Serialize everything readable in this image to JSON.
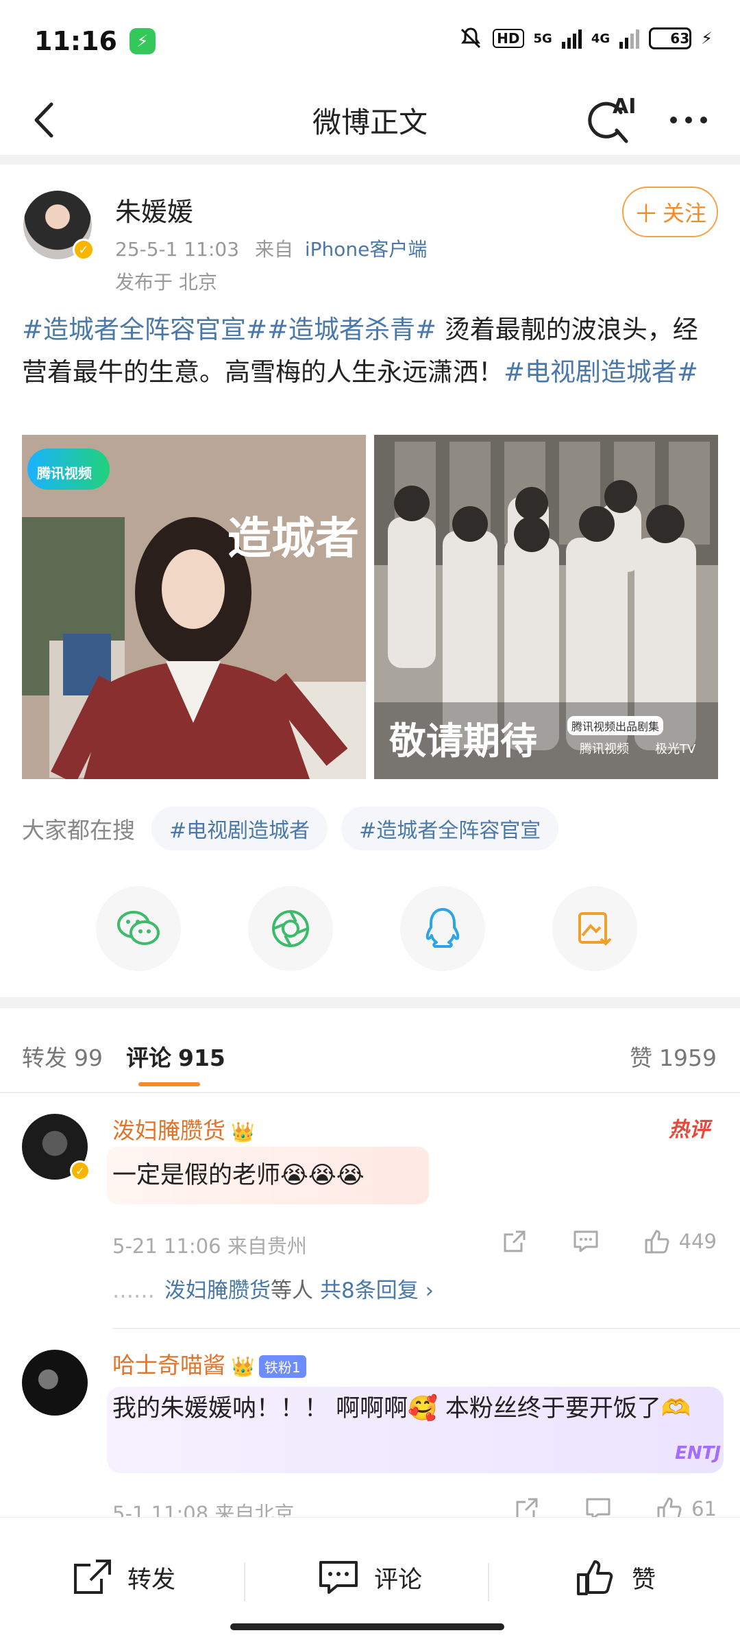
{
  "status_bar": {
    "time": "11:16",
    "network1": "5G",
    "network2": "4G",
    "hd": "HD",
    "battery": "63"
  },
  "nav": {
    "title": "微博正文",
    "ai_label": "AI"
  },
  "post": {
    "author": "朱媛媛",
    "time": "25-5-1 11:03",
    "from_label": "来自",
    "source": "iPhone客户端",
    "location": "发布于 北京",
    "follow_label": "关注",
    "text": {
      "topic1": "#造城者全阵容官宣#",
      "topic2": "#造城者杀青#",
      "body": " 烫着最靓的波浪头，经营着最牛的生意。高雪梅的人生永远潇洒！",
      "topic3": "#电视剧造城者#"
    },
    "images": [
      {
        "logo_text": "腾讯视频",
        "title_text": "造城者"
      },
      {
        "banner_text": "敬请期待",
        "sub_text": "腾讯视频出品剧集",
        "brand1": "腾讯视频",
        "brand2": "极光TV"
      }
    ]
  },
  "search": {
    "label": "大家都在搜",
    "chips": [
      "#电视剧造城者",
      "#造城者全阵容官宣"
    ]
  },
  "share_icons": [
    "wechat-icon",
    "moments-icon",
    "qq-icon",
    "save-image-icon"
  ],
  "tabs": {
    "repost": {
      "label": "转发",
      "count": "99"
    },
    "comment": {
      "label": "评论",
      "count": "915"
    },
    "like": {
      "label": "赞",
      "count": "1959"
    }
  },
  "comments": [
    {
      "user": "泼妇腌臜货",
      "text": "一定是假的老师😭😭😭",
      "meta": "5-21 11:06 来自贵州",
      "likes": "449",
      "hot": "热评",
      "replies_user": "泼妇腌臜货",
      "replies_suffix": "等人",
      "replies_count": "共8条回复 ›",
      "replies_dots": "……"
    },
    {
      "user": "哈士奇喵酱",
      "fan_badge": "铁粉1",
      "text": "我的朱媛媛呐！！！ 啊啊啊🥰 本粉丝终于要开饭了🫶",
      "meta": "5-1 11:08 来自北京",
      "likes": "61",
      "bubble_text": "ENTJ"
    }
  ],
  "bottom_bar": {
    "repost": "转发",
    "comment": "评论",
    "like": "赞"
  },
  "colors": {
    "accent": "#f08c2a",
    "link": "#4a78a8",
    "name": "#e0742a"
  }
}
